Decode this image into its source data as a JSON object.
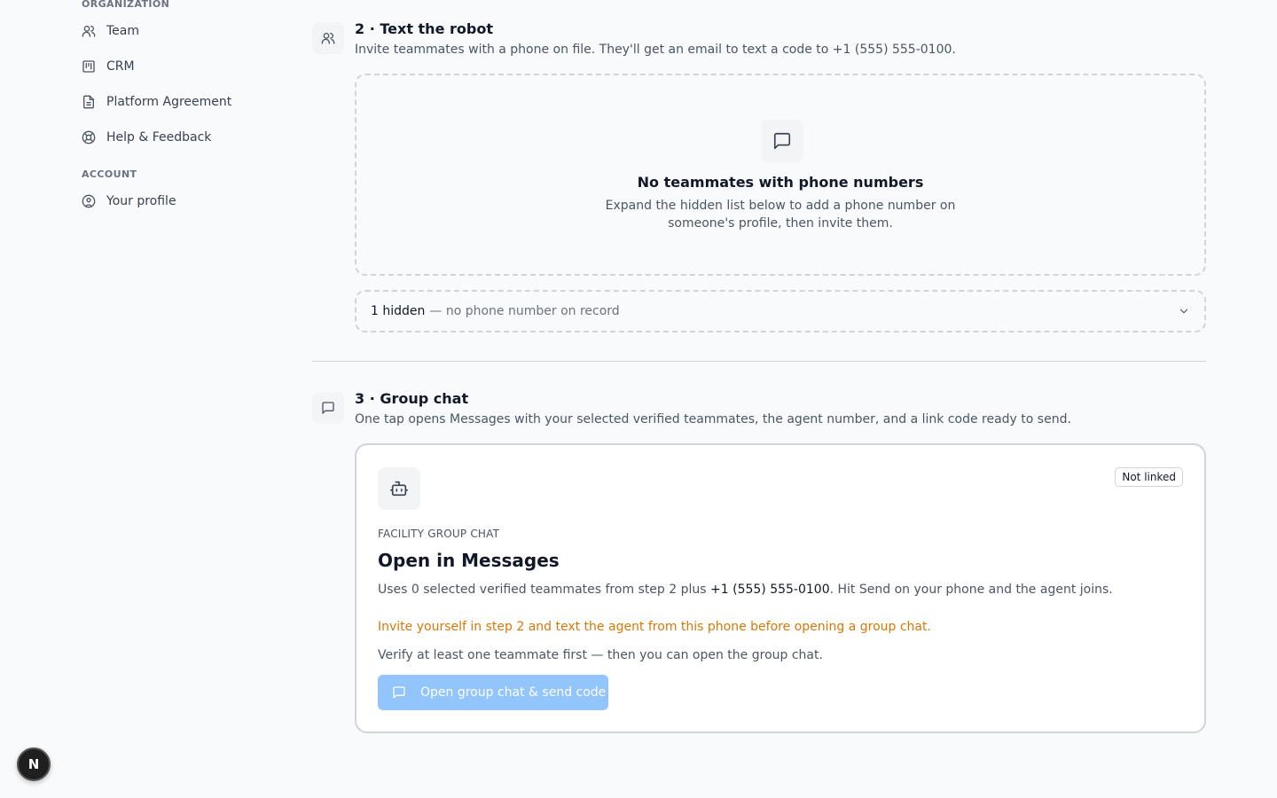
{
  "sidebar": {
    "org_label": "ORGANIZATION",
    "org_items": [
      {
        "label": "Team",
        "icon": "users-icon"
      },
      {
        "label": "CRM",
        "icon": "kanban-icon"
      },
      {
        "label": "Platform Agreement",
        "icon": "document-icon"
      },
      {
        "label": "Help & Feedback",
        "icon": "lifebuoy-icon"
      }
    ],
    "account_label": "ACCOUNT",
    "account_items": [
      {
        "label": "Your profile",
        "icon": "user-circle-icon"
      }
    ]
  },
  "step2": {
    "title": "2 · Text the robot",
    "description": "Invite teammates with a phone on file. They'll get an email to text a code to +1 (555) 555-0100.",
    "empty": {
      "title": "No teammates with phone numbers",
      "description": "Expand the hidden list below to add a phone number on someone's profile, then invite them."
    },
    "hidden": {
      "count_text": "1 hidden",
      "reason_text": "— no phone number on record"
    }
  },
  "step3": {
    "title": "3 · Group chat",
    "description": "One tap opens Messages with your selected verified teammates, the agent number, and a link code ready to send.",
    "card": {
      "status_badge": "Not linked",
      "eyebrow": "FACILITY GROUP CHAT",
      "title": "Open in Messages",
      "desc_prefix": "Uses 0 selected verified teammates from step 2 plus ",
      "desc_phone": "+1 (555) 555-0100",
      "desc_suffix": ". Hit Send on your phone and the agent joins.",
      "warning": "Invite yourself in step 2 and text the agent from this phone before opening a group chat.",
      "note": "Verify at least one teammate first — then you can open the group chat.",
      "cta_label": "Open group chat & send code"
    }
  },
  "dev_badge": "N",
  "colors": {
    "warning": "#d97706",
    "cta_disabled": "#93c5fd",
    "background": "#f9fafb"
  }
}
